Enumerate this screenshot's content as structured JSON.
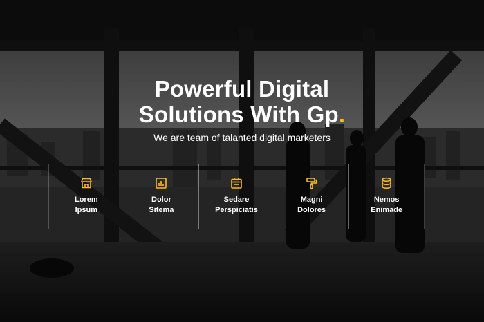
{
  "hero": {
    "title_line1": "Powerful Digital",
    "title_line2": "Solutions With Gp",
    "title_dot": ".",
    "subtitle": "We are team of talanted digital marketers",
    "accent_color": "#ffbc13"
  },
  "features": [
    {
      "line1": "Lorem",
      "line2": "Ipsum",
      "icon": "store-icon"
    },
    {
      "line1": "Dolor",
      "line2": "Sitema",
      "icon": "bar-chart-icon"
    },
    {
      "line1": "Sedare",
      "line2": "Perspiciatis",
      "icon": "calendar-icon"
    },
    {
      "line1": "Magni",
      "line2": "Dolores",
      "icon": "paint-roller-icon"
    },
    {
      "line1": "Nemos",
      "line2": "Enimade",
      "icon": "database-icon"
    }
  ]
}
